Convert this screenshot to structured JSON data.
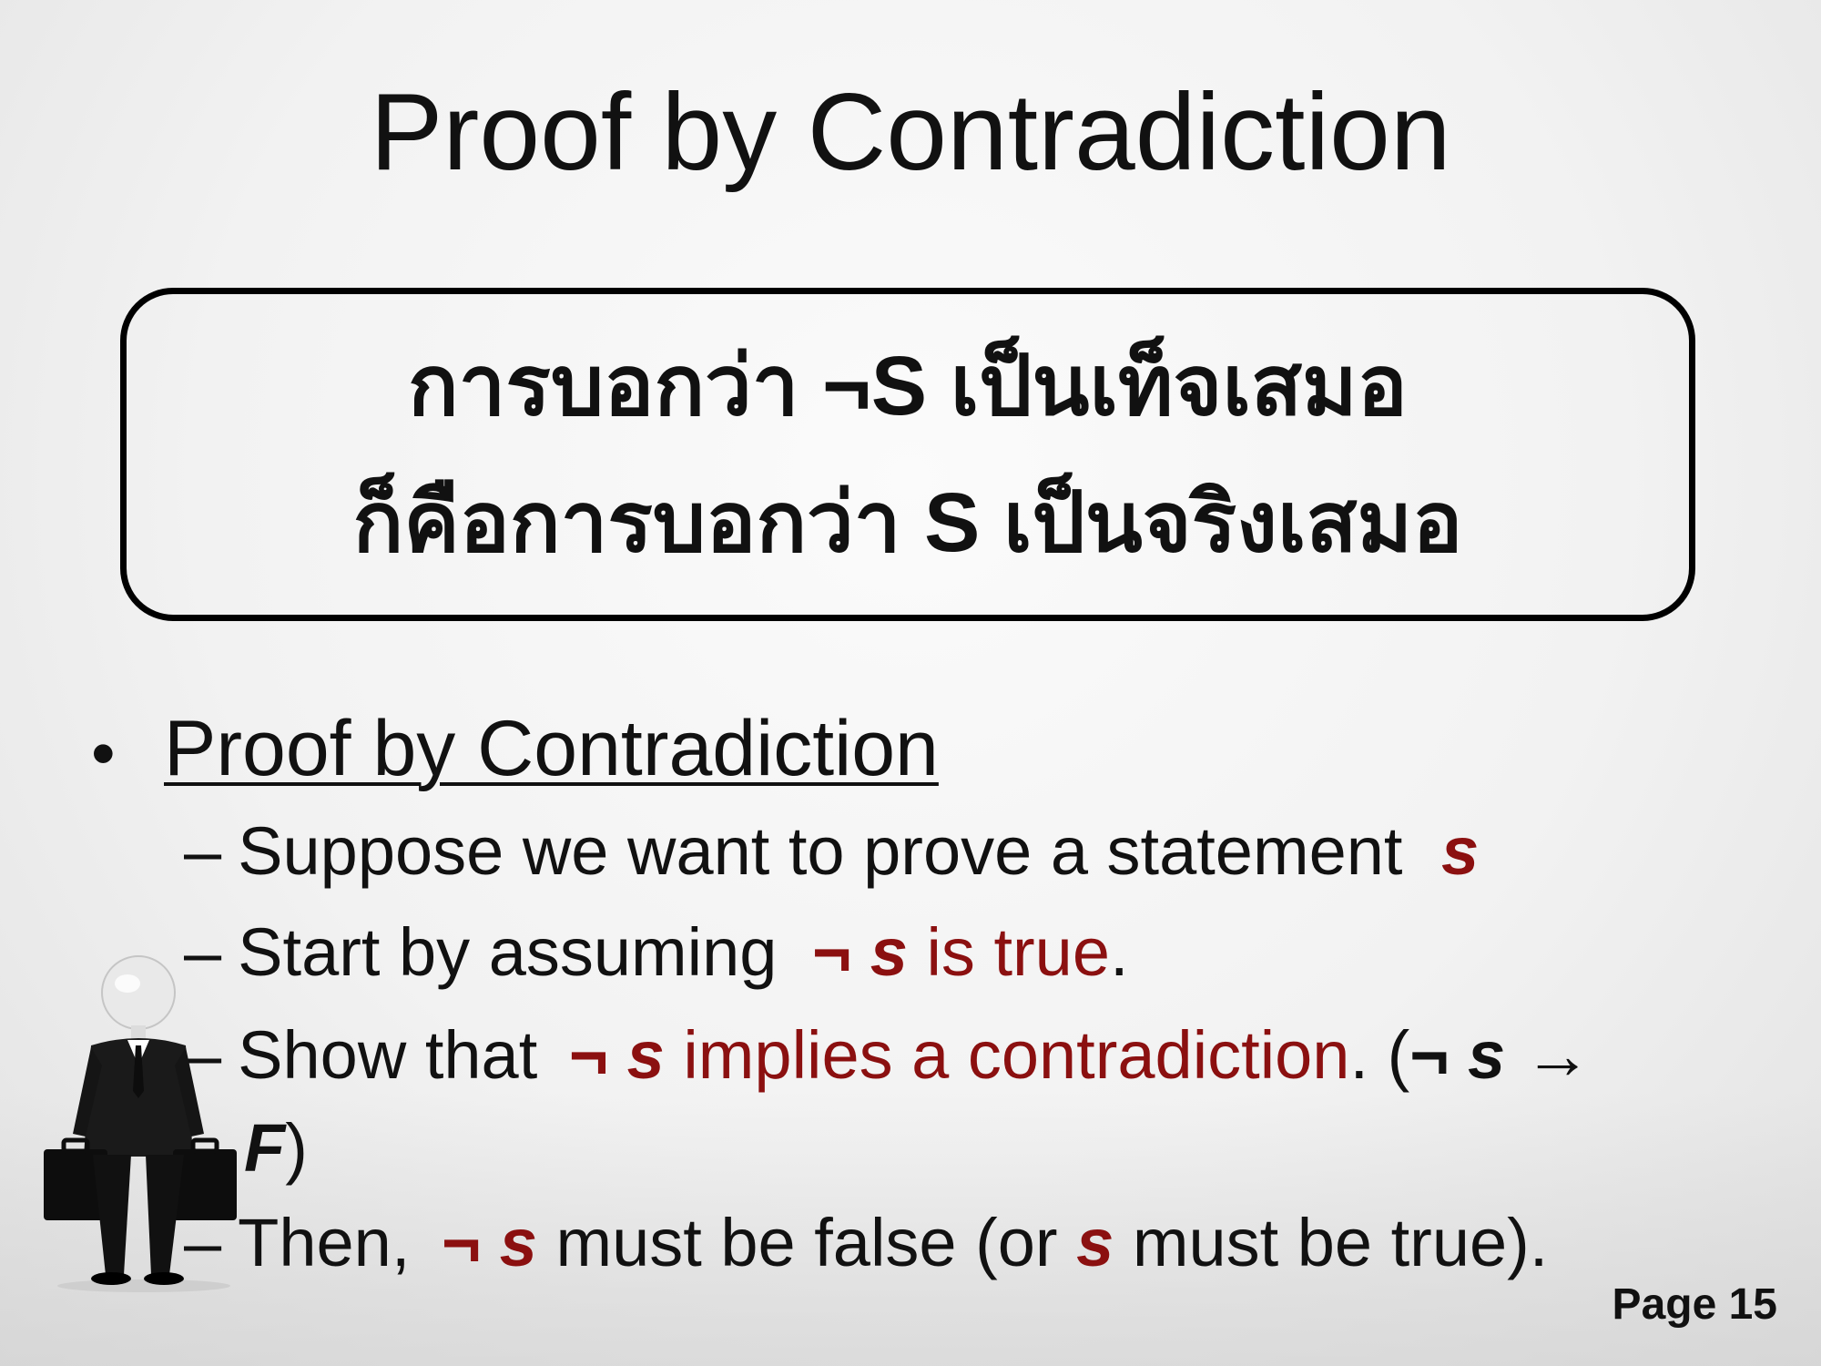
{
  "slide": {
    "title": "Proof by Contradiction",
    "callout": {
      "line1": "การบอกว่า ¬S เป็นเท็จเสมอ",
      "line2": "ก็คือการบอกว่า S เป็นจริงเสมอ"
    },
    "bullet": {
      "heading": "Proof by Contradiction",
      "items": [
        {
          "dash": "–",
          "text_a": "Suppose we want to prove a statement ",
          "s": "s"
        },
        {
          "dash": "–",
          "text_a": "Start by assuming ",
          "neg": "¬",
          "s": "s",
          "text_b": " is true",
          "tail": "."
        },
        {
          "dash": "–",
          "text_a": "Show that ",
          "neg": "¬",
          "s": "s",
          "text_b": " implies a contradiction",
          "tail": ". (",
          "neg2": "¬",
          "s2": "s",
          "arrow": " → ",
          "f": "F",
          "close": ")"
        },
        {
          "dash": "–",
          "text_a": "Then, ",
          "neg": "¬",
          "s": "s",
          "text_b": " must be false (or ",
          "s2": "s",
          "text_c": " must be true)."
        }
      ]
    },
    "page_label": "Page 15"
  },
  "figure": {
    "icon": "businessman-with-briefcases-icon"
  },
  "colors": {
    "accent_red": "#8b1010",
    "text": "#111111"
  }
}
